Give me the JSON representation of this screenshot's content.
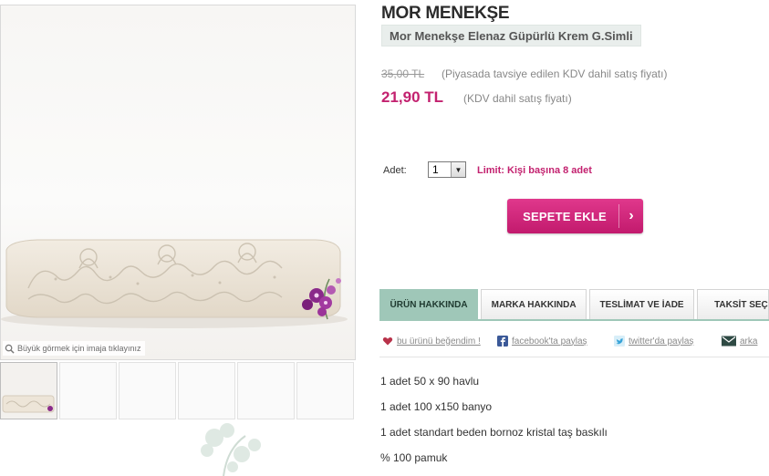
{
  "product": {
    "brand": "MOR MENEKŞE",
    "name": "Mor Menekşe Elenaz Güpürlü Krem G.Simli"
  },
  "image": {
    "zoom_hint": "Büyük görmek için imaja tıklayınız",
    "zoom_icon": "magnifier-icon",
    "thumbnail_count": 6
  },
  "pricing": {
    "old_price": "35,00 TL",
    "old_price_note": "(Piyasada tavsiye edilen KDV dahil satış fiyatı)",
    "new_price": "21,90 TL",
    "new_price_note": "(KDV dahil satış fiyatı)",
    "accent_color": "#c3216f"
  },
  "quantity": {
    "label": "Adet:",
    "selected": "1",
    "limit_text": "Limit: Kişi başına 8 adet"
  },
  "cart": {
    "button_label": "SEPETE EKLE",
    "chevron": "›"
  },
  "tabs": [
    {
      "label": "ÜRÜN HAKKINDA",
      "active": true
    },
    {
      "label": "MARKA HAKKINDA",
      "active": false
    },
    {
      "label": "TESLİMAT VE İADE",
      "active": false
    },
    {
      "label": "TAKSİT SEÇ",
      "active": false
    }
  ],
  "social": {
    "like": "bu ürünü beğendim !",
    "facebook": "facebook'ta paylaş",
    "twitter": "twitter'da paylaş",
    "mail": "arka"
  },
  "description": [
    "1 adet 50 x 90 havlu",
    "1 adet 100 x150 banyo",
    "1 adet standart beden bornoz kristal taş baskılı",
    "% 100 pamuk"
  ],
  "colors": {
    "tab_active": "#9fc7b8",
    "button_gradient_top": "#e0388c",
    "button_gradient_bottom": "#c21a6d"
  }
}
